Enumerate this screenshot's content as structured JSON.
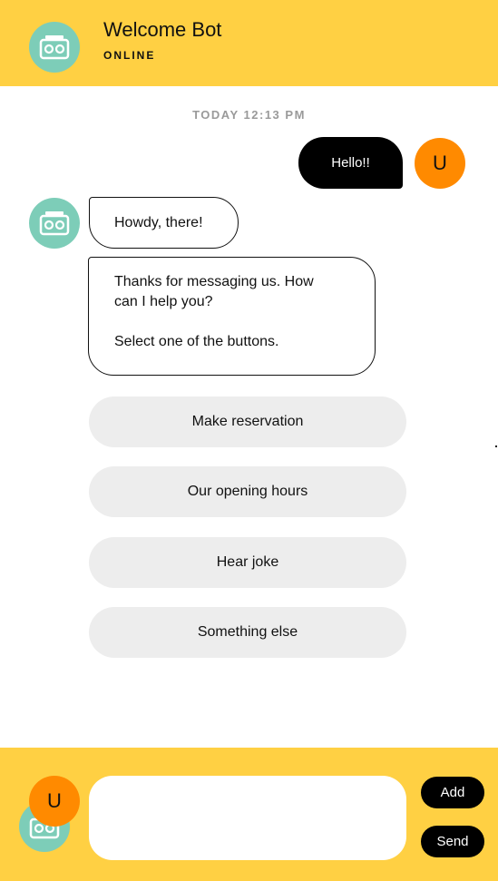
{
  "header": {
    "bot_avatar_icon": "robot-icon",
    "title": "Welcome Bot",
    "status": "ONLINE"
  },
  "conversation": {
    "timestamp": "TODAY 12:13 PM",
    "user_message": {
      "text": "Hello!!",
      "avatar_letter": "U"
    },
    "bot_messages": [
      {
        "text": "Howdy, there!"
      },
      {
        "text": "Thanks for messaging us. How\ncan I help you?\n\nSelect one of the buttons."
      }
    ],
    "quick_replies": [
      {
        "label": "Make reservation"
      },
      {
        "label": "Our opening hours"
      },
      {
        "label": "Hear joke"
      },
      {
        "label": "Something else"
      }
    ]
  },
  "composer": {
    "user_avatar_letter": "U",
    "input_value": "",
    "add_label": "Add",
    "send_label": "Send"
  },
  "colors": {
    "brand_yellow": "#FFD043",
    "bot_avatar": "#7DCDB8",
    "user_avatar": "#FF8A00",
    "quick_reply_bg": "#EDEDED",
    "user_bubble": "#000000"
  }
}
